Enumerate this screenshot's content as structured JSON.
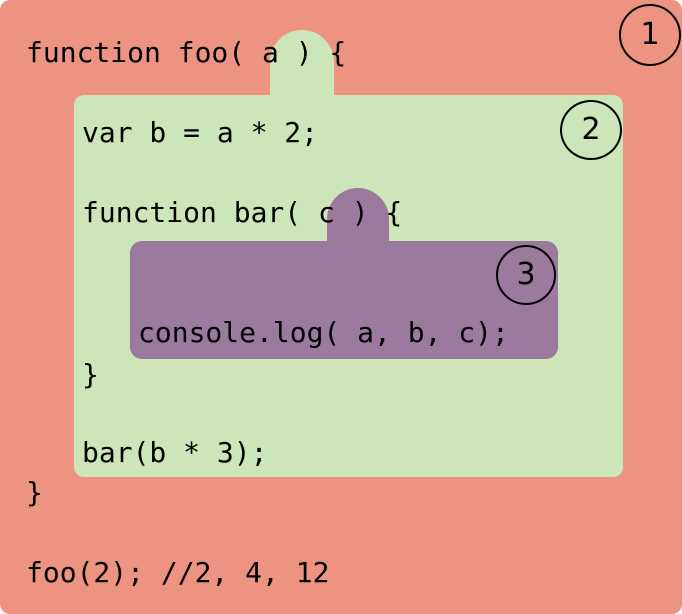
{
  "scopes": [
    {
      "label": "1",
      "color": "#ec9382"
    },
    {
      "label": "2",
      "color": "#cce5b9"
    },
    {
      "label": "3",
      "color": "#9c7aa0"
    }
  ],
  "code": {
    "line_foo_decl": "function foo( a ) {",
    "line_var_b": "var b = a * 2;",
    "line_bar_decl": "function bar( c ) {",
    "line_console": "console.log( a, b, c);",
    "line_bar_close": "}",
    "line_bar_call": "bar(b * 3);",
    "line_foo_close": "}",
    "line_foo_call": "foo(2); //2, 4, 12"
  }
}
